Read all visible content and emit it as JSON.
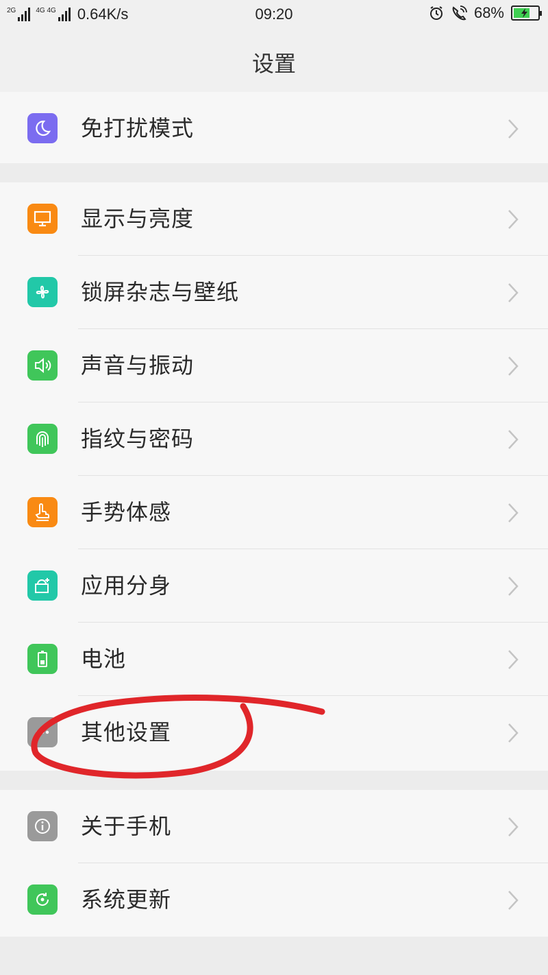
{
  "status_bar": {
    "sim1_label": "2G",
    "sim2_label": "4G 4G",
    "net_speed": "0.64K/s",
    "time": "09:20",
    "battery_pct": "68%",
    "battery_level": 0.68,
    "icons": [
      "signal-icon",
      "signal-icon",
      "alarm-icon",
      "wifi-call-icon",
      "battery-charging-icon"
    ]
  },
  "header": {
    "title": "设置"
  },
  "groups": [
    {
      "items": [
        {
          "label": "免打扰模式",
          "icon": "moon-icon",
          "color": "#7b6cf0"
        }
      ]
    },
    {
      "items": [
        {
          "label": "显示与亮度",
          "icon": "monitor-icon",
          "color": "#f98a13"
        },
        {
          "label": "锁屏杂志与壁纸",
          "icon": "pinwheel-icon",
          "color": "#22c8a8"
        },
        {
          "label": "声音与振动",
          "icon": "speaker-icon",
          "color": "#40c65a"
        },
        {
          "label": "指纹与密码",
          "icon": "fingerprint-icon",
          "color": "#40c65a"
        },
        {
          "label": "手势体感",
          "icon": "hand-gesture-icon",
          "color": "#f98a13"
        },
        {
          "label": "应用分身",
          "icon": "app-clone-icon",
          "color": "#22c8a8"
        },
        {
          "label": "电池",
          "icon": "battery-icon",
          "color": "#40c65a"
        },
        {
          "label": "其他设置",
          "icon": "more-settings-icon",
          "color": "#9a9a9a"
        }
      ]
    },
    {
      "items": [
        {
          "label": "关于手机",
          "icon": "info-icon",
          "color": "#9a9a9a"
        },
        {
          "label": "系统更新",
          "icon": "update-icon",
          "color": "#40c65a"
        }
      ]
    }
  ],
  "annotation": {
    "description_icon": "red-circle-annotation",
    "color": "#e0262a"
  }
}
